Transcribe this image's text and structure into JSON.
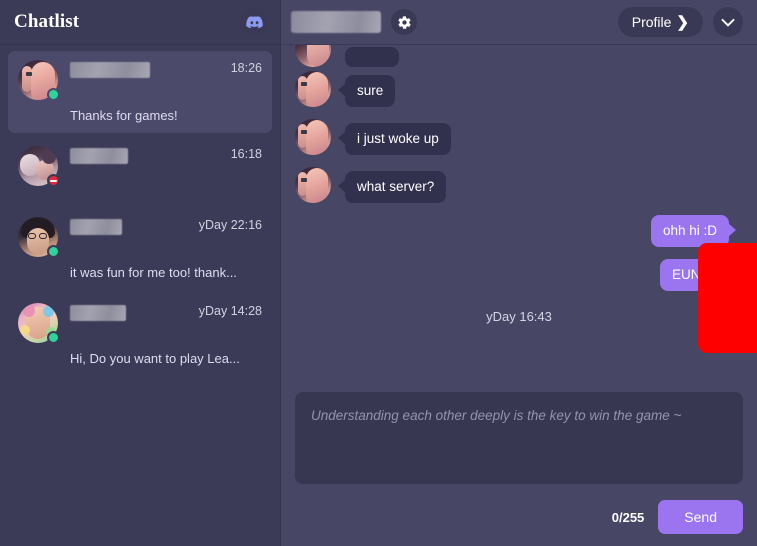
{
  "sidebar": {
    "title": "Chatlist",
    "logo_icon": "discord-icon",
    "items": [
      {
        "name_redacted": true,
        "time": "18:26",
        "preview": "Thanks for games!",
        "status": "online",
        "selected": true
      },
      {
        "name_redacted": true,
        "time": "16:18",
        "preview": "",
        "status": "dnd",
        "selected": false
      },
      {
        "name_redacted": true,
        "time": "yDay 22:16",
        "preview": "it was fun for me too! thank...",
        "status": "online",
        "selected": false
      },
      {
        "name_redacted": true,
        "time": "yDay 14:28",
        "preview": "Hi, Do you want to play Lea...",
        "status": "online",
        "selected": false
      }
    ]
  },
  "header": {
    "name_redacted": true,
    "settings_icon": "gear-icon",
    "profile_label": "Profile",
    "profile_chevron": "❯",
    "collapse_icon": "chevron-down-icon"
  },
  "messages": {
    "items": [
      {
        "direction": "in",
        "text": "sure"
      },
      {
        "direction": "in",
        "text": "i just woke up"
      },
      {
        "direction": "in",
        "text": "what server?"
      },
      {
        "direction": "out",
        "text": "ohh hi :D"
      },
      {
        "direction": "out",
        "text": "EUNE?"
      }
    ],
    "day_divider": "yDay 16:43",
    "redaction_color": "#ff0000"
  },
  "composer": {
    "placeholder": "Understanding each other deeply is the key to win the game ~",
    "value": "",
    "counter": "0/255",
    "send_label": "Send"
  },
  "colors": {
    "sidebar_bg": "#3c3b57",
    "main_bg": "#474665",
    "bubble_in": "#32314d",
    "bubble_out": "#9b74ef",
    "accent": "#9b74ef",
    "online": "#2fd39a",
    "dnd": "#e02b3c",
    "discord_blurple": "#8b9bf0"
  }
}
